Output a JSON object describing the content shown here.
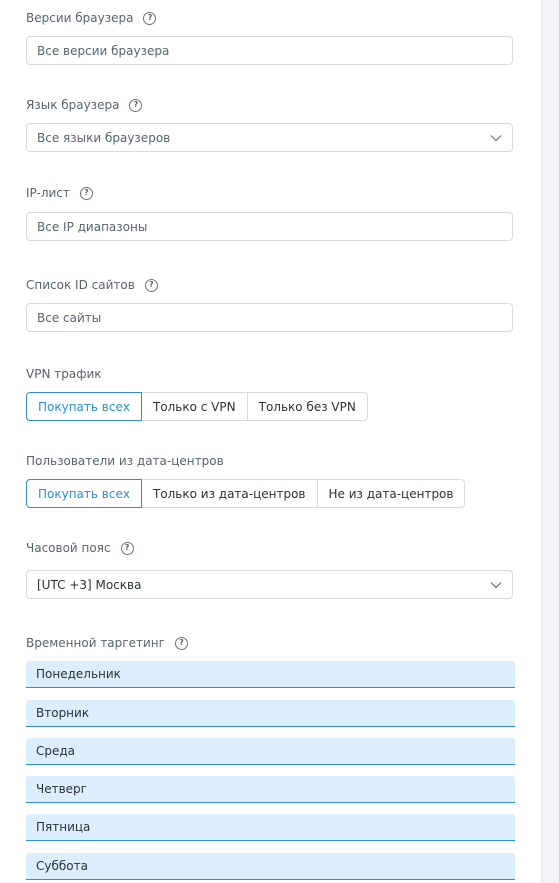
{
  "browser_versions": {
    "label": "Версии браузера",
    "placeholder": "Все версии браузера"
  },
  "browser_language": {
    "label": "Язык браузера",
    "value": "Все языки браузеров"
  },
  "ip_list": {
    "label": "IP-лист",
    "placeholder": "Все IP диапазоны"
  },
  "site_ids": {
    "label": "Список ID сайтов",
    "placeholder": "Все сайты"
  },
  "vpn": {
    "label": "VPN трафик",
    "options": [
      "Покупать всех",
      "Только с VPN",
      "Только без VPN"
    ],
    "selected": "Покупать всех"
  },
  "datacenter": {
    "label": "Пользователи из дата-центров",
    "options": [
      "Покупать всех",
      "Только из дата-центров",
      "Не из дата-центров"
    ],
    "selected": "Покупать всех"
  },
  "timezone": {
    "label": "Часовой пояс",
    "value": "[UTC +3] Москва"
  },
  "time_targeting": {
    "label": "Временной таргетинг",
    "days": [
      "Понедельник",
      "Вторник",
      "Среда",
      "Четверг",
      "Пятница",
      "Суббота"
    ]
  },
  "colors": {
    "accent": "#2d8fd5",
    "day_bg": "#ddeefd",
    "border": "#d6dae1"
  },
  "icons": {
    "help": "question-circle-icon",
    "dropdown": "chevron-down-icon"
  }
}
